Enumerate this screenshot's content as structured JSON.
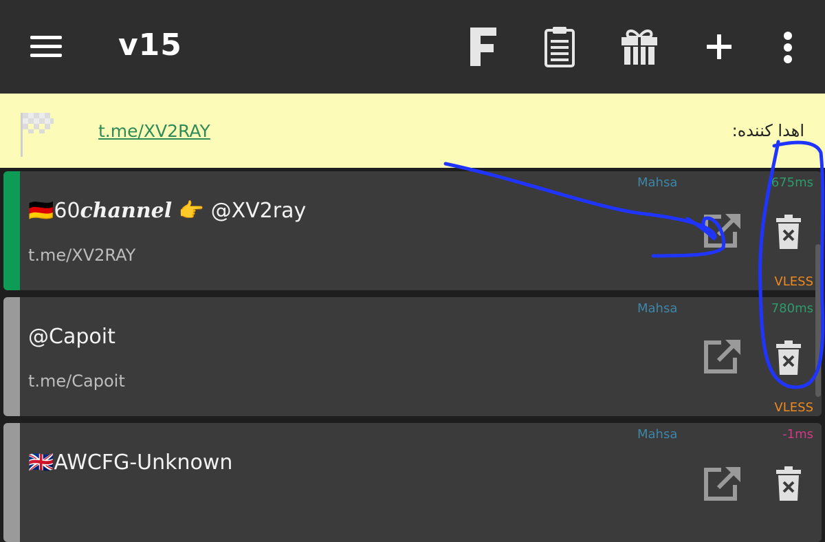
{
  "appbar": {
    "title": "v15",
    "icons": [
      "menu-icon",
      "fragment-icon",
      "clipboard-icon",
      "gift-icon",
      "plus-icon",
      "more-vert-icon"
    ]
  },
  "banner": {
    "link": "t.me/XV2RAY",
    "donor_label": "اهدا کننده:"
  },
  "servers": [
    {
      "name_prefix": "🇩🇪60",
      "name_styled": "channel",
      "name_suffix": " 👉 @XV2ray",
      "subtitle": "t.me/XV2RAY",
      "group": "Mahsa",
      "delay": "675ms",
      "delay_color": "#2e9b6a",
      "type": "VLESS",
      "stripe_color": "#0e9b55",
      "selected": true
    },
    {
      "name_prefix": "@Capoit",
      "name_styled": "",
      "name_suffix": "",
      "subtitle": "t.me/Capoit",
      "group": "Mahsa",
      "delay": "780ms",
      "delay_color": "#2e9b6a",
      "type": "VLESS",
      "stripe_color": "#9a9a9a",
      "selected": false
    },
    {
      "name_prefix": "🇬🇧AWCFG-Unknown",
      "name_styled": "",
      "name_suffix": "",
      "subtitle": "",
      "group": "Mahsa",
      "delay": "-1ms",
      "delay_color": "#d13a86",
      "type": "",
      "stripe_color": "#9a9a9a",
      "selected": false
    }
  ],
  "colors": {
    "appbar_bg": "#2e2e2e",
    "banner_bg": "#fcfcb8",
    "card_bg": "#3b3b3b",
    "annotation_ink": "#1f35ff"
  }
}
